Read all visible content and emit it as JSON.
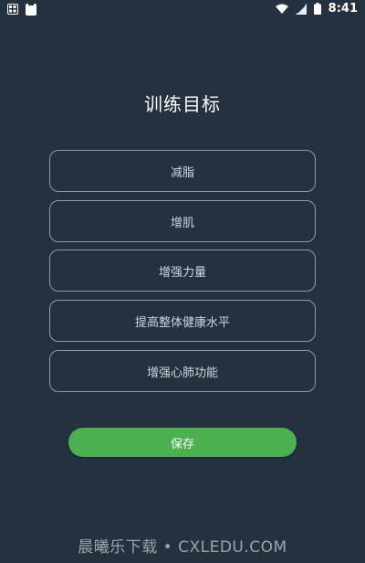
{
  "status_bar": {
    "time": "8:41",
    "icons": [
      "gallery-icon",
      "clipboard-icon",
      "wifi-icon",
      "signal-icon",
      "battery-icon"
    ]
  },
  "page": {
    "title": "训练目标"
  },
  "options": [
    {
      "label": "减脂"
    },
    {
      "label": "增肌"
    },
    {
      "label": "增强力量"
    },
    {
      "label": "提高整体健康水平"
    },
    {
      "label": "增强心肺功能"
    }
  ],
  "actions": {
    "save_label": "保存"
  },
  "watermark": {
    "text": "晨曦乐下载 • CXLEDU.COM"
  },
  "colors": {
    "background": "#24313f",
    "accent": "#4caf50",
    "border": "#8f9aa6",
    "text": "#ffffff"
  }
}
